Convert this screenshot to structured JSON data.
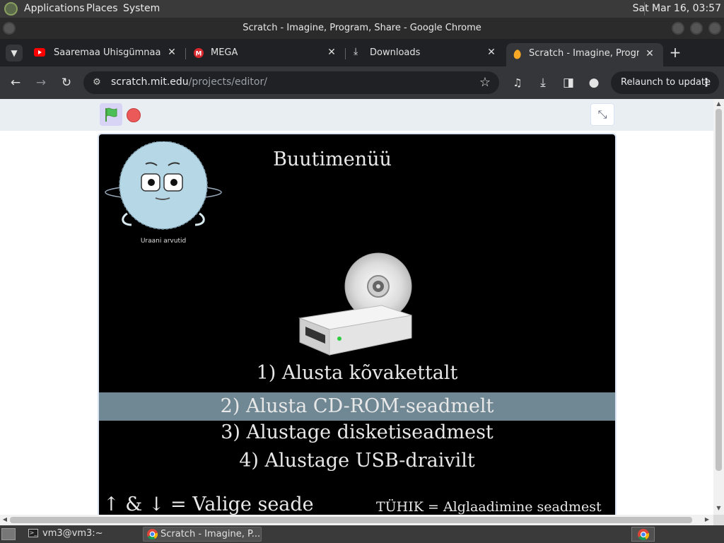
{
  "top_panel": {
    "menus": [
      "Applications",
      "Places",
      "System"
    ],
    "clock": "Sat Mar 16, 03:57"
  },
  "window": {
    "title": "Scratch - Imagine, Program, Share - Google Chrome"
  },
  "tabs": [
    {
      "label": "Saaremaa Ühisgümnaasium",
      "icon": "youtube-icon",
      "active": false
    },
    {
      "label": "MEGA",
      "icon": "mega-icon",
      "active": false
    },
    {
      "label": "Downloads",
      "icon": "download-icon",
      "active": false
    },
    {
      "label": "Scratch - Imagine, Program",
      "icon": "scratch-icon",
      "active": true
    }
  ],
  "toolbar": {
    "url_host": "scratch.mit.edu",
    "url_path": "/projects/editor/",
    "relaunch_label": "Relaunch to update"
  },
  "stage": {
    "heading": "Buutimenüü",
    "logo_caption": "Uraani arvutid",
    "options": [
      "1) Alusta kõvakettalt",
      "2) Alusta CD-ROM-seadmelt",
      "3) Alustage disketiseadmest",
      "4) Alustage USB-draivilt"
    ],
    "selected_option": 2,
    "hint_left": "↑ & ↓ = Valige seade",
    "hint_right": "TÜHIK = Alglaadimine seadmest"
  },
  "taskbar": {
    "items": [
      {
        "label": "vm3@vm3:~",
        "icon": "terminal-icon",
        "active": false
      },
      {
        "label": "Scratch - Imagine, P...",
        "icon": "chrome-icon",
        "active": true
      }
    ]
  },
  "colors": {
    "chrome_dark": "#202124",
    "toolbar": "#35363a",
    "stage_bg": "#000000",
    "selected_option_bg": "#6f8894",
    "stop_red": "#ec5959",
    "flag_green": "#4cbf56"
  }
}
